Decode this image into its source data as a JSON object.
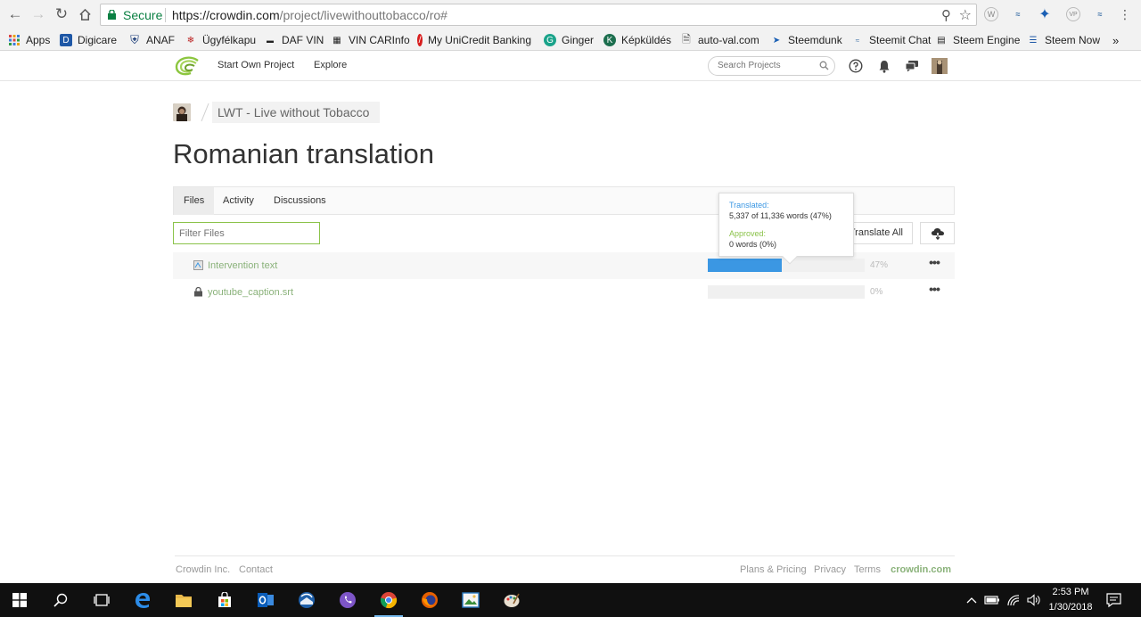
{
  "browser": {
    "secure_label": "Secure",
    "url_host": "https://crowdin.com",
    "url_path": "/project/livewithouttobacco/ro#"
  },
  "bookmarks": [
    {
      "label": "Apps"
    },
    {
      "label": "Digicare"
    },
    {
      "label": "ANAF"
    },
    {
      "label": "Ügyfélkapu"
    },
    {
      "label": "DAF VIN"
    },
    {
      "label": "VIN CARInfo"
    },
    {
      "label": "My UniCredit Banking"
    },
    {
      "label": "Ginger"
    },
    {
      "label": "Képküldés"
    },
    {
      "label": "auto-val.com"
    },
    {
      "label": "Steemdunk"
    },
    {
      "label": "Steemit Chat"
    },
    {
      "label": "Steem Engine"
    },
    {
      "label": "Steem Now"
    }
  ],
  "site_nav": {
    "start_project": "Start Own Project",
    "explore": "Explore",
    "search_placeholder": "Search Projects"
  },
  "breadcrumb": {
    "project_name": "LWT - Live without Tobacco"
  },
  "page_title": "Romanian translation",
  "tabs": [
    {
      "label": "Files"
    },
    {
      "label": "Activity"
    },
    {
      "label": "Discussions"
    }
  ],
  "toolbar": {
    "filter_placeholder": "Filter Files",
    "translate_all": "Translate All"
  },
  "files": [
    {
      "name": "Intervention text",
      "progress": 0.47,
      "percent_label": "47%"
    },
    {
      "name": "youtube_caption.srt",
      "progress": 0.0,
      "percent_label": "0%"
    }
  ],
  "tooltip": {
    "translated_label": "Translated:",
    "translated_value": "5,337 of 11,336 words (47%)",
    "approved_label": "Approved:",
    "approved_value": "0 words (0%)"
  },
  "footer": {
    "company": "Crowdin Inc.",
    "contact": "Contact",
    "plans": "Plans & Pricing",
    "privacy": "Privacy",
    "terms": "Terms",
    "site": "crowdin.com"
  },
  "taskbar": {
    "time": "2:53 PM",
    "date": "1/30/2018"
  },
  "colors": {
    "progress_fill": "#3b97e3",
    "link_green": "#8ab27a",
    "secure_green": "#0b8043"
  }
}
